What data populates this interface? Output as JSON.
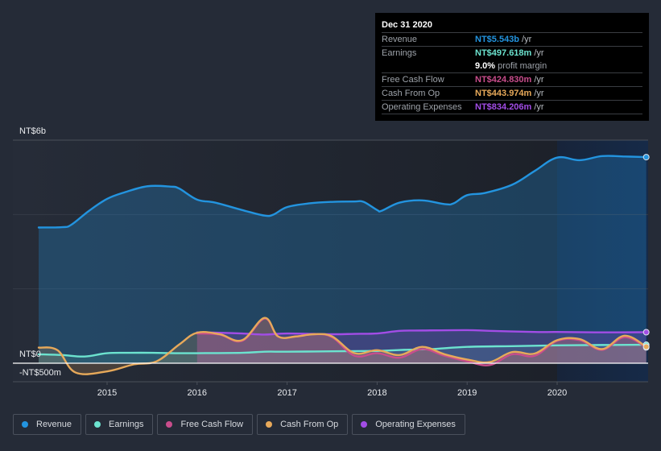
{
  "tooltip": {
    "date": "Dec 31 2020",
    "rows": [
      {
        "label": "Revenue",
        "value": "NT$5.543b",
        "unit": "/yr",
        "color": "#2394df"
      },
      {
        "label": "Earnings",
        "value": "NT$497.618m",
        "unit": "/yr",
        "color": "#6ce3cf"
      },
      {
        "label": "",
        "value": "9.0%",
        "unit": "profit margin",
        "color": "#ffffff"
      },
      {
        "label": "Free Cash Flow",
        "value": "NT$424.830m",
        "unit": "/yr",
        "color": "#c94d8c"
      },
      {
        "label": "Cash From Op",
        "value": "NT$443.974m",
        "unit": "/yr",
        "color": "#e7a95a"
      },
      {
        "label": "Operating Expenses",
        "value": "NT$834.206m",
        "unit": "/yr",
        "color": "#a24de6"
      }
    ]
  },
  "legend": [
    {
      "label": "Revenue",
      "color": "#2394df"
    },
    {
      "label": "Earnings",
      "color": "#6ce3cf"
    },
    {
      "label": "Free Cash Flow",
      "color": "#c94d8c"
    },
    {
      "label": "Cash From Op",
      "color": "#e7a95a"
    },
    {
      "label": "Operating Expenses",
      "color": "#a24de6"
    }
  ],
  "chart_data": {
    "type": "line",
    "title": "",
    "xlabel": "",
    "ylabel": "",
    "y_unit": "NT$ billions",
    "ylim": [
      -0.5,
      6
    ],
    "xlim": [
      2014.0,
      2021.0
    ],
    "y_tick_labels": [
      {
        "value": 6,
        "label": "NT$6b"
      },
      {
        "value": 0,
        "label": "NT$0"
      },
      {
        "value": -0.5,
        "label": "-NT$500m"
      }
    ],
    "gridlines_y": [
      6,
      4,
      2
    ],
    "x_ticks": [
      2015,
      2016,
      2017,
      2018,
      2019,
      2020
    ],
    "x_tick_labels": [
      "2015",
      "2016",
      "2017",
      "2018",
      "2019",
      "2020"
    ],
    "highlight_from": 2020.0,
    "legend_position": "bottom-left",
    "series": [
      {
        "name": "Revenue",
        "color": "#2394df",
        "fill": true,
        "points": [
          [
            2014.24,
            3.65
          ],
          [
            2014.5,
            3.66
          ],
          [
            2014.6,
            3.72
          ],
          [
            2014.8,
            4.1
          ],
          [
            2015.0,
            4.42
          ],
          [
            2015.2,
            4.6
          ],
          [
            2015.45,
            4.76
          ],
          [
            2015.7,
            4.75
          ],
          [
            2015.8,
            4.7
          ],
          [
            2016.0,
            4.4
          ],
          [
            2016.2,
            4.32
          ],
          [
            2016.5,
            4.12
          ],
          [
            2016.75,
            3.97
          ],
          [
            2016.85,
            4.0
          ],
          [
            2017.0,
            4.2
          ],
          [
            2017.25,
            4.3
          ],
          [
            2017.5,
            4.34
          ],
          [
            2017.75,
            4.35
          ],
          [
            2017.85,
            4.34
          ],
          [
            2018.0,
            4.12
          ],
          [
            2018.05,
            4.1
          ],
          [
            2018.25,
            4.32
          ],
          [
            2018.5,
            4.38
          ],
          [
            2018.75,
            4.28
          ],
          [
            2018.85,
            4.3
          ],
          [
            2019.0,
            4.52
          ],
          [
            2019.2,
            4.58
          ],
          [
            2019.5,
            4.8
          ],
          [
            2019.75,
            5.17
          ],
          [
            2020.0,
            5.53
          ],
          [
            2020.25,
            5.46
          ],
          [
            2020.5,
            5.57
          ],
          [
            2020.75,
            5.56
          ],
          [
            2020.99,
            5.543
          ]
        ]
      },
      {
        "name": "Earnings",
        "color": "#6ce3cf",
        "fill": true,
        "points": [
          [
            2014.24,
            0.24
          ],
          [
            2014.5,
            0.22
          ],
          [
            2014.75,
            0.18
          ],
          [
            2015.0,
            0.27
          ],
          [
            2015.25,
            0.28
          ],
          [
            2015.5,
            0.28
          ],
          [
            2015.75,
            0.27
          ],
          [
            2016.0,
            0.27
          ],
          [
            2016.5,
            0.28
          ],
          [
            2016.75,
            0.31
          ],
          [
            2017.0,
            0.31
          ],
          [
            2017.5,
            0.32
          ],
          [
            2017.9,
            0.33
          ],
          [
            2018.0,
            0.33
          ],
          [
            2018.3,
            0.36
          ],
          [
            2018.6,
            0.38
          ],
          [
            2019.0,
            0.44
          ],
          [
            2019.5,
            0.46
          ],
          [
            2020.0,
            0.48
          ],
          [
            2020.5,
            0.49
          ],
          [
            2020.99,
            0.4976
          ]
        ]
      },
      {
        "name": "Free Cash Flow",
        "color": "#c94d8c",
        "fill": true,
        "points": [
          [
            2016.0,
            0.8
          ],
          [
            2016.25,
            0.77
          ],
          [
            2016.5,
            0.6
          ],
          [
            2016.75,
            1.2
          ],
          [
            2016.9,
            0.72
          ],
          [
            2017.1,
            0.72
          ],
          [
            2017.3,
            0.78
          ],
          [
            2017.5,
            0.7
          ],
          [
            2017.75,
            0.2
          ],
          [
            2018.0,
            0.27
          ],
          [
            2018.25,
            0.15
          ],
          [
            2018.5,
            0.38
          ],
          [
            2018.75,
            0.2
          ],
          [
            2019.0,
            0.05
          ],
          [
            2019.25,
            -0.05
          ],
          [
            2019.5,
            0.24
          ],
          [
            2019.75,
            0.2
          ],
          [
            2020.0,
            0.6
          ],
          [
            2020.25,
            0.62
          ],
          [
            2020.5,
            0.36
          ],
          [
            2020.75,
            0.7
          ],
          [
            2020.99,
            0.4248
          ]
        ]
      },
      {
        "name": "Cash From Op",
        "color": "#e7a95a",
        "fill": true,
        "points": [
          [
            2014.24,
            0.42
          ],
          [
            2014.45,
            0.35
          ],
          [
            2014.65,
            -0.25
          ],
          [
            2015.0,
            -0.22
          ],
          [
            2015.3,
            -0.03
          ],
          [
            2015.55,
            0.05
          ],
          [
            2015.8,
            0.5
          ],
          [
            2016.0,
            0.82
          ],
          [
            2016.25,
            0.78
          ],
          [
            2016.5,
            0.62
          ],
          [
            2016.75,
            1.22
          ],
          [
            2016.9,
            0.72
          ],
          [
            2017.1,
            0.72
          ],
          [
            2017.3,
            0.78
          ],
          [
            2017.5,
            0.72
          ],
          [
            2017.75,
            0.27
          ],
          [
            2018.0,
            0.35
          ],
          [
            2018.25,
            0.22
          ],
          [
            2018.5,
            0.44
          ],
          [
            2018.75,
            0.24
          ],
          [
            2019.0,
            0.1
          ],
          [
            2019.25,
            0.03
          ],
          [
            2019.5,
            0.3
          ],
          [
            2019.75,
            0.26
          ],
          [
            2020.0,
            0.62
          ],
          [
            2020.25,
            0.65
          ],
          [
            2020.5,
            0.38
          ],
          [
            2020.75,
            0.74
          ],
          [
            2020.99,
            0.444
          ]
        ]
      },
      {
        "name": "Operating Expenses",
        "color": "#a24de6",
        "fill": true,
        "points": [
          [
            2016.0,
            0.83
          ],
          [
            2016.25,
            0.82
          ],
          [
            2016.5,
            0.8
          ],
          [
            2016.75,
            0.77
          ],
          [
            2017.0,
            0.8
          ],
          [
            2017.5,
            0.78
          ],
          [
            2017.75,
            0.79
          ],
          [
            2018.0,
            0.8
          ],
          [
            2018.25,
            0.87
          ],
          [
            2018.5,
            0.88
          ],
          [
            2019.0,
            0.89
          ],
          [
            2019.25,
            0.87
          ],
          [
            2019.75,
            0.84
          ],
          [
            2020.0,
            0.84
          ],
          [
            2020.5,
            0.83
          ],
          [
            2020.99,
            0.8342
          ]
        ]
      }
    ]
  }
}
